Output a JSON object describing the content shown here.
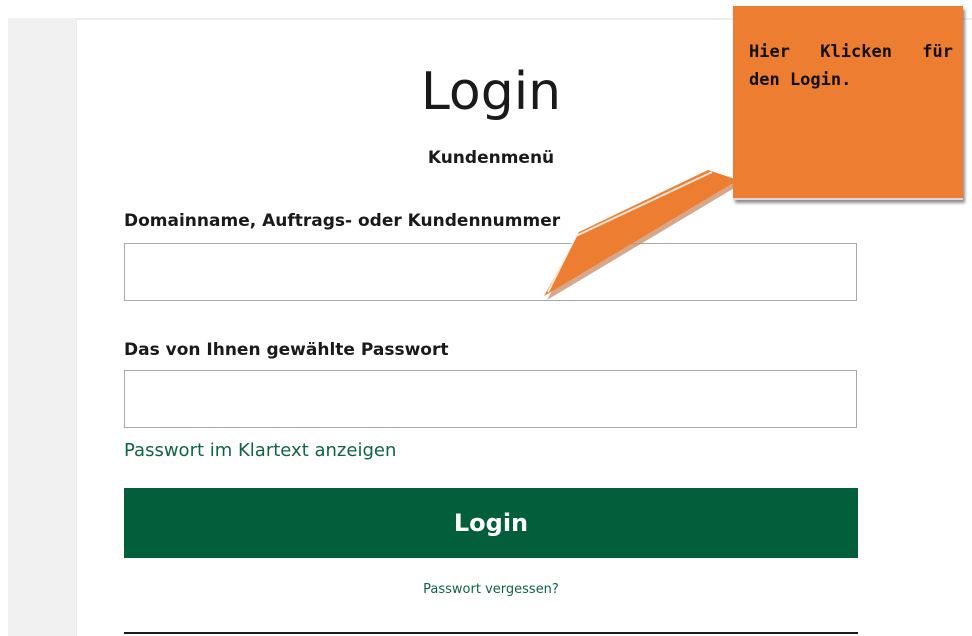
{
  "login": {
    "title": "Login",
    "subtitle": "Kundenmenü",
    "username_label": "Domainname, Auftrags- oder Kundennummer",
    "username_value": "",
    "password_label": "Das von Ihnen gewählte Passwort",
    "password_value": "",
    "show_password_link": "Passwort im Klartext anzeigen",
    "submit_label": "Login",
    "forgot_link": "Passwort vergessen?"
  },
  "callout": {
    "text": "Hier Klicken für den Login.",
    "color": "#ed7d31"
  },
  "colors": {
    "primary": "#035e3c",
    "link": "#0f6441"
  }
}
